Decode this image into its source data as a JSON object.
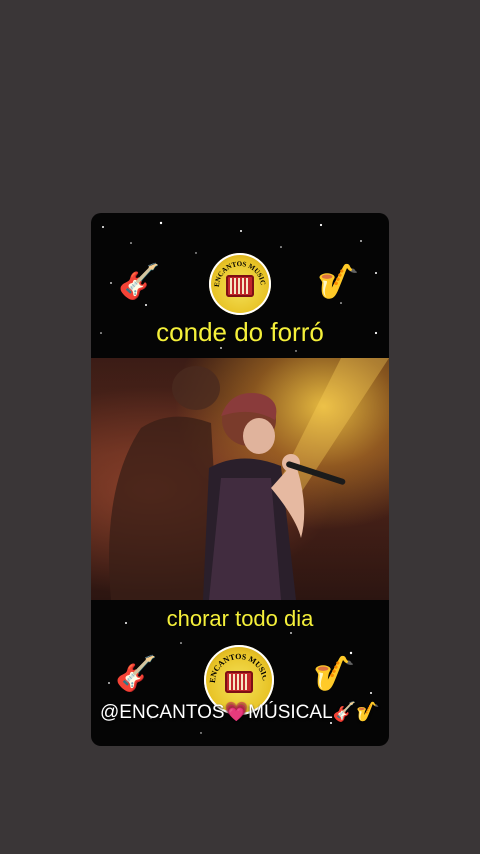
{
  "video": {
    "top_caption": "conde do forró",
    "bottom_caption": "chorar todo dia",
    "handle": "@ENCANTOS💗MÚSICAL🎸🎷",
    "logo_text": "ENCANTOS MUSICAL"
  },
  "icons": {
    "guitar": "🎸",
    "sax": "🎷"
  },
  "colors": {
    "caption": "#f5f03a",
    "background": "#3a3637"
  }
}
